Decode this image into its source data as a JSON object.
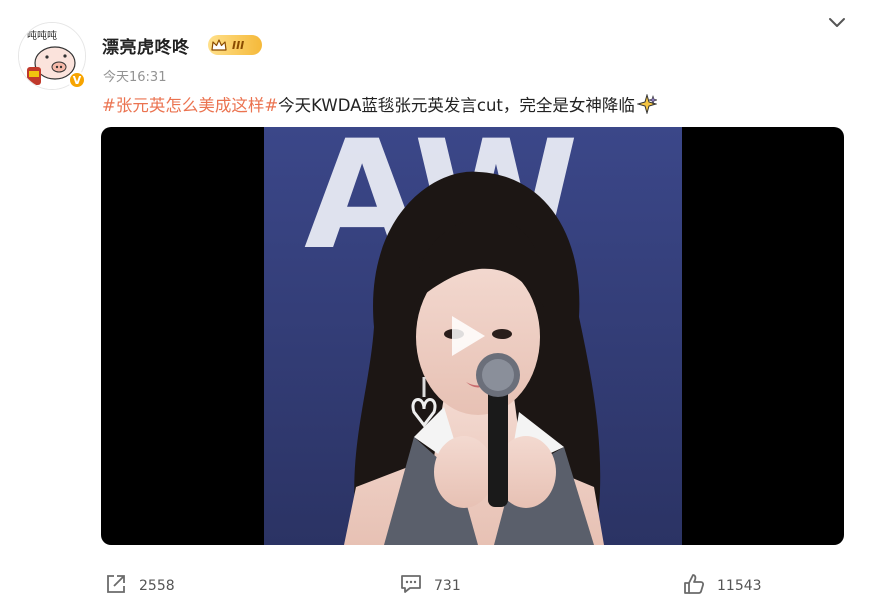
{
  "post": {
    "username": "漂亮虎咚咚",
    "rank_level": "III",
    "timestamp": "今天16:31",
    "hashtag": "#张元英怎么美成这样#",
    "text": "今天KWDA蓝毯张元英发言cut，完全是女神降临",
    "verified_mark": "V",
    "avatar_caption": "吨吨吨"
  },
  "video": {
    "backdrop_letters": "AW"
  },
  "actions": {
    "share_count": "2558",
    "comment_count": "731",
    "like_count": "11543"
  },
  "colors": {
    "hashtag": "#eb7350",
    "badge": "#f5b93a",
    "verified": "#f7a400",
    "video_bg": "#000000"
  },
  "icons": [
    "chevron-down-icon",
    "crown-icon",
    "sparkle-icon",
    "play-icon",
    "share-icon",
    "comment-icon",
    "like-icon"
  ]
}
